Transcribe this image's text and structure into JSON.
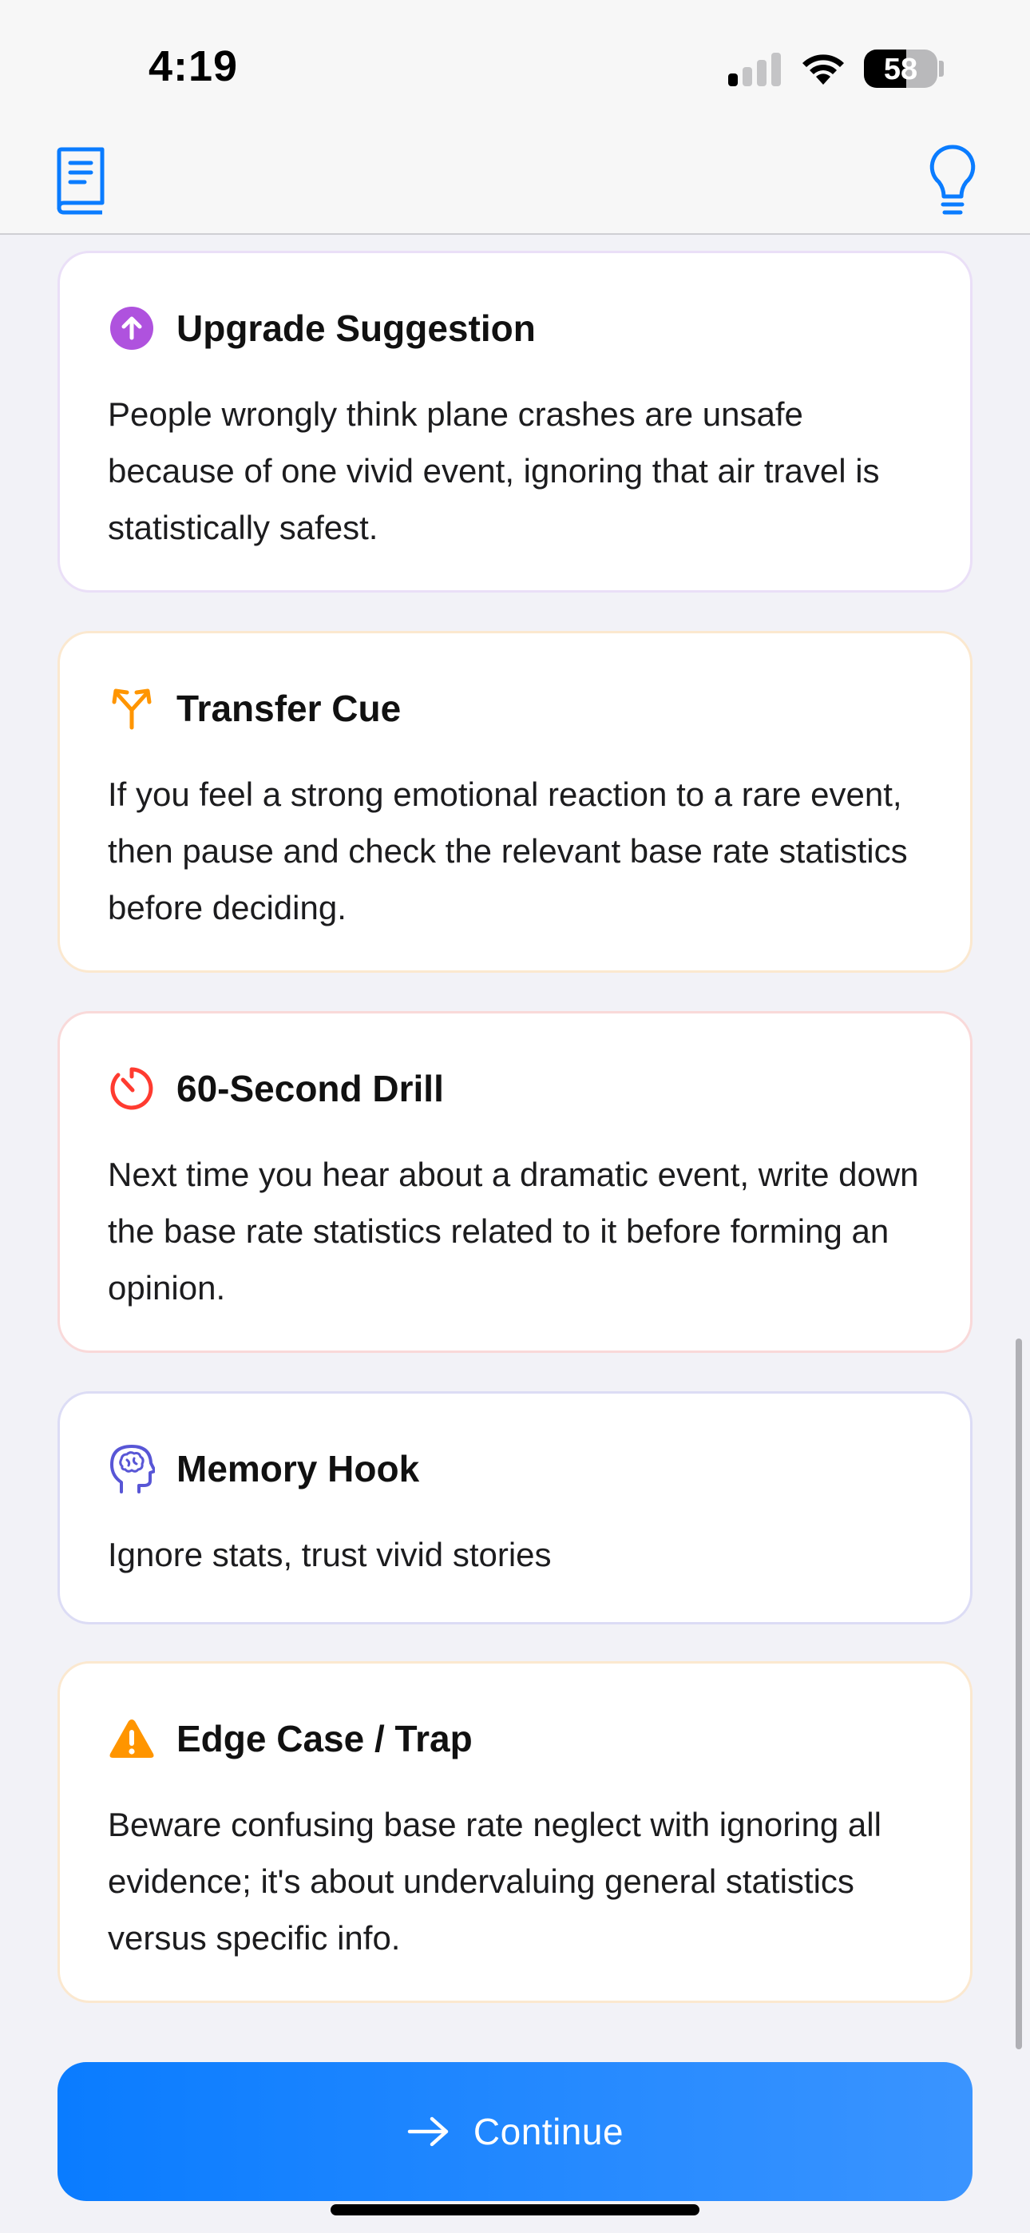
{
  "status_bar": {
    "time": "4:19",
    "battery": "58",
    "battery_level_percent": 58,
    "signal_bars_active": 1,
    "signal_bars_total": 4
  },
  "nav": {
    "left_icon": "book-icon",
    "right_icon": "lightbulb-icon",
    "accent_color": "#0a7cff"
  },
  "cards": [
    {
      "icon": "arrow-up-circle-icon",
      "icon_color": "#af52de",
      "border_color": "#eadff7",
      "title": "Upgrade Suggestion",
      "body": "People wrongly think plane crashes are unsafe because of one vivid event, ignoring that air travel is statistically safest."
    },
    {
      "icon": "split-arrows-icon",
      "icon_color": "#ff9500",
      "border_color": "#fbe8cf",
      "title": "Transfer Cue",
      "body": "If you feel a strong emotional reaction to a rare event, then pause and check the relevant base rate statistics before deciding."
    },
    {
      "icon": "timer-icon",
      "icon_color": "#ff3b30",
      "border_color": "#f9d9d9",
      "title": "60-Second Drill",
      "body": "Next time you hear about a dramatic event, write down the base rate statistics related to it before forming an opinion."
    },
    {
      "icon": "brain-head-icon",
      "icon_color": "#5856d6",
      "border_color": "#dcdcf5",
      "title": "Memory Hook",
      "body": "Ignore stats, trust vivid stories"
    },
    {
      "icon": "warning-triangle-icon",
      "icon_color": "#ff9500",
      "border_color": "#fbe8cf",
      "title": "Edge Case / Trap",
      "body": "Beware confusing base rate neglect with ignoring all evidence; it's about undervaluing general statistics versus specific info."
    }
  ],
  "continue_button": {
    "label": "Continue",
    "icon": "arrow-right-icon"
  }
}
